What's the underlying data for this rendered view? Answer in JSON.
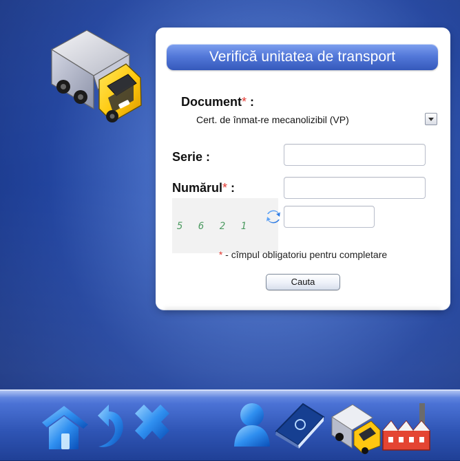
{
  "panel": {
    "title": "Verifică unitatea de transport",
    "document_label": "Document",
    "document_suffix": " :",
    "document_value": "Cert. de înmat-re mecanolizibil (VP)",
    "serie_label": "Serie :",
    "numar_label": "Numărul",
    "numar_suffix": " :",
    "required_star": "*",
    "captcha_text": "5 6 2 1",
    "required_note": " - cîmpul obligatoriu pentru completare",
    "search_button": "Cauta"
  },
  "colors": {
    "background": "#2f55b5",
    "title_bar": "#5378d9",
    "required": "#e3372f",
    "captcha": "#4d9b62"
  },
  "icons": {
    "hero": "truck-icon",
    "toolbar": [
      "home-icon",
      "back-icon",
      "close-icon",
      "user-icon",
      "document-book-icon",
      "truck-icon",
      "factory-icon"
    ]
  }
}
